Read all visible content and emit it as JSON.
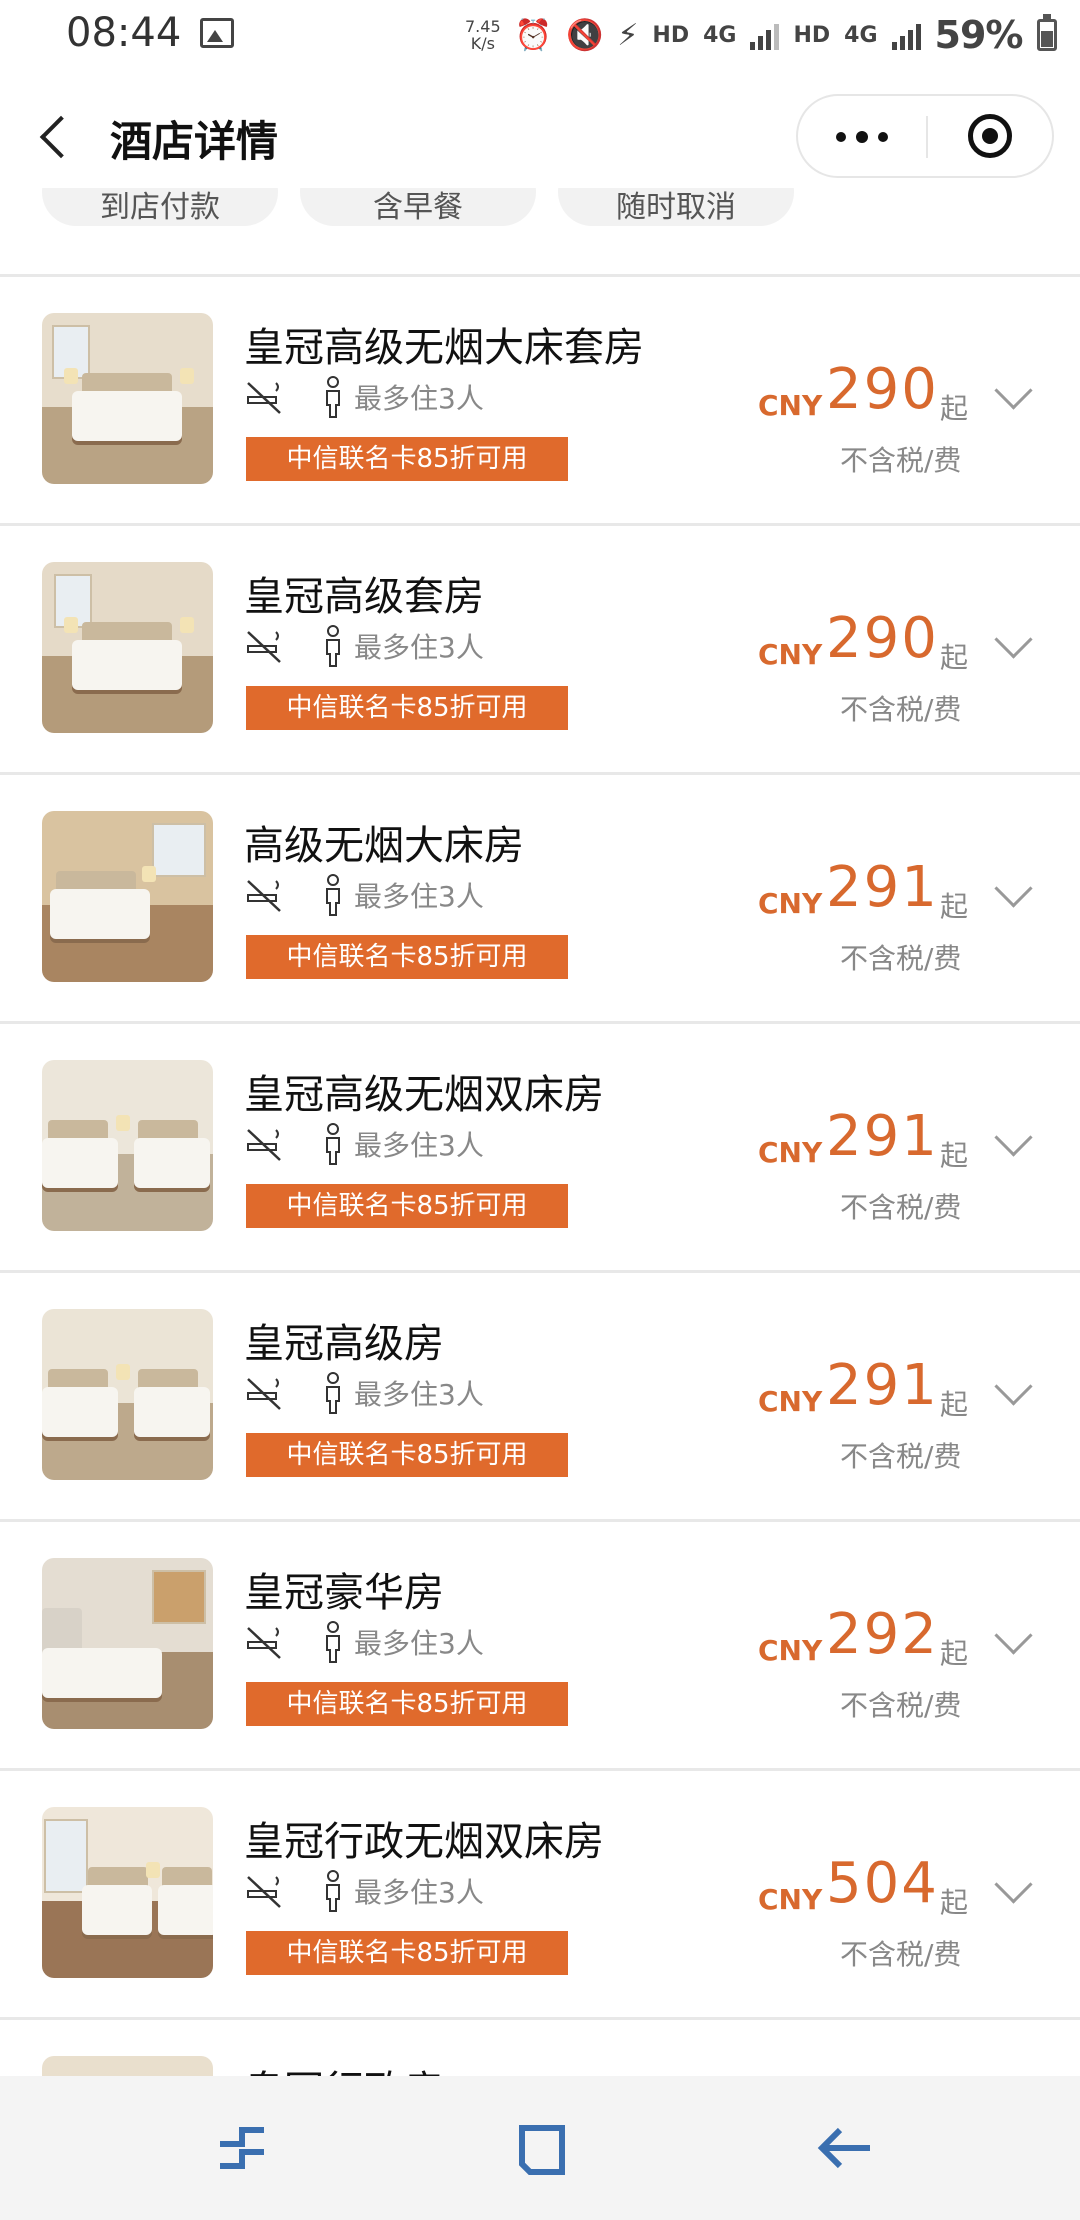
{
  "status_bar": {
    "time": "08:44",
    "net_speed_value": "7.45",
    "net_speed_unit": "K/s",
    "hd1": "HD",
    "net1": "4G",
    "hd2": "HD",
    "net2": "4G",
    "battery": "59%"
  },
  "header": {
    "title": "酒店详情"
  },
  "tags": [
    "到店付款",
    "含早餐",
    "随时取消"
  ],
  "rooms": [
    {
      "name": "皇冠高级无烟大床套房",
      "occupancy": "最多住3人",
      "promo": "中信联名卡85折可用",
      "currency": "CNY",
      "price": "290",
      "suffix": "起",
      "tax": "不含税/费"
    },
    {
      "name": "皇冠高级套房",
      "occupancy": "最多住3人",
      "promo": "中信联名卡85折可用",
      "currency": "CNY",
      "price": "290",
      "suffix": "起",
      "tax": "不含税/费"
    },
    {
      "name": "高级无烟大床房",
      "occupancy": "最多住3人",
      "promo": "中信联名卡85折可用",
      "currency": "CNY",
      "price": "291",
      "suffix": "起",
      "tax": "不含税/费"
    },
    {
      "name": "皇冠高级无烟双床房",
      "occupancy": "最多住3人",
      "promo": "中信联名卡85折可用",
      "currency": "CNY",
      "price": "291",
      "suffix": "起",
      "tax": "不含税/费"
    },
    {
      "name": "皇冠高级房",
      "occupancy": "最多住3人",
      "promo": "中信联名卡85折可用",
      "currency": "CNY",
      "price": "291",
      "suffix": "起",
      "tax": "不含税/费"
    },
    {
      "name": "皇冠豪华房",
      "occupancy": "最多住3人",
      "promo": "中信联名卡85折可用",
      "currency": "CNY",
      "price": "292",
      "suffix": "起",
      "tax": "不含税/费"
    },
    {
      "name": "皇冠行政无烟双床房",
      "occupancy": "最多住3人",
      "promo": "中信联名卡85折可用",
      "currency": "CNY",
      "price": "504",
      "suffix": "起",
      "tax": "不含税/费"
    },
    {
      "name": "皇冠行政房"
    }
  ],
  "colors": {
    "accent": "#d8692e",
    "promo_bg": "#e06a2c",
    "divider": "#e8e8e8",
    "nav_icon": "#3a6fb0"
  },
  "icons": {
    "back": "chevron-left-icon",
    "more": "more-dots-icon",
    "close": "target-close-icon",
    "no_smoking": "no-smoking-icon",
    "person": "person-icon",
    "expand": "chevron-down-icon"
  }
}
